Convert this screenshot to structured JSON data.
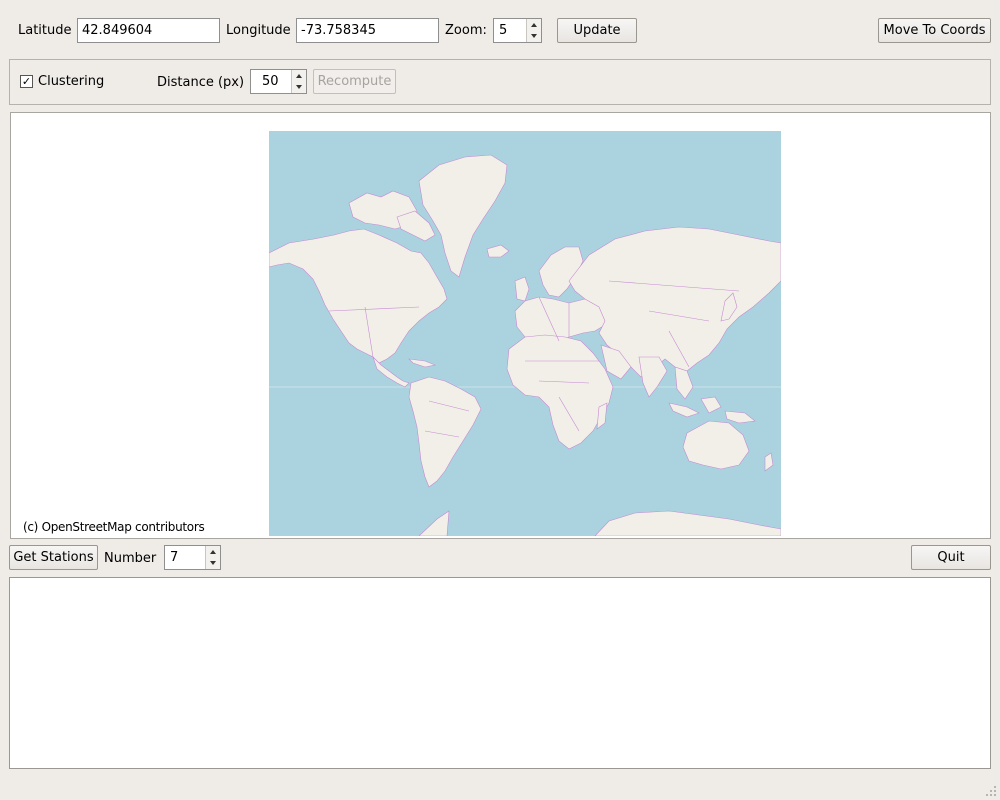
{
  "toolbar": {
    "latitude_label": "Latitude",
    "latitude_value": "42.849604",
    "longitude_label": "Longitude",
    "longitude_value": "-73.758345",
    "zoom_label": "Zoom:",
    "zoom_value": "5",
    "update_label": "Update",
    "move_label": "Move To Coords"
  },
  "clustering": {
    "checkbox_label": "Clustering",
    "checked_mark": "✓",
    "distance_label": "Distance (px)",
    "distance_value": "50",
    "recompute_label": "Recompute"
  },
  "map": {
    "attribution": "(c) OpenStreetMap contributors",
    "ocean_color": "#aad3df",
    "land_color": "#f2efe9",
    "border_color": "#c58bd1"
  },
  "stations": {
    "get_label": "Get Stations",
    "number_label": "Number",
    "number_value": "7",
    "quit_label": "Quit"
  },
  "results": {
    "text": ""
  }
}
